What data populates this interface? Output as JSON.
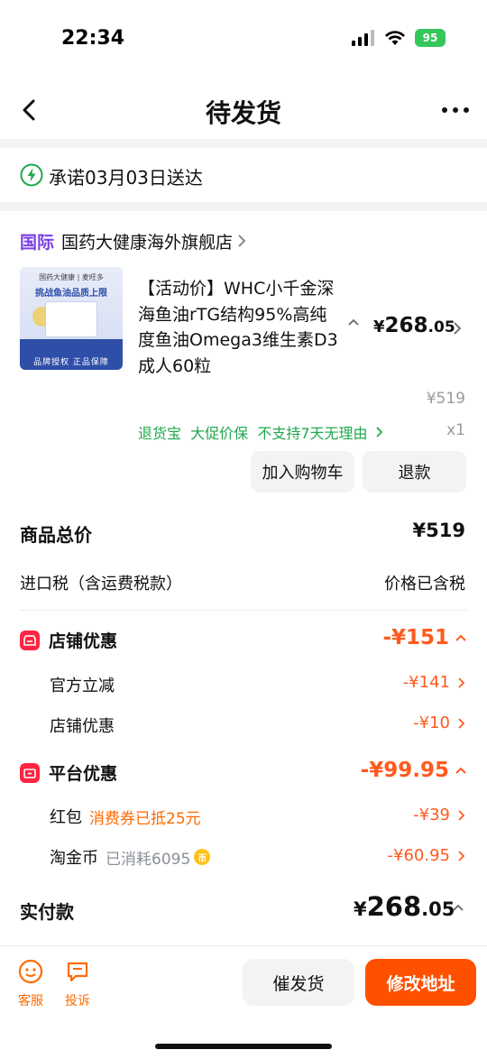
{
  "status_bar": {
    "time": "22:34",
    "battery": "95"
  },
  "nav": {
    "title": "待发货"
  },
  "delivery": {
    "text": "承诺03月03日送达"
  },
  "shop": {
    "tag": "国际",
    "name": "国药大健康海外旗舰店"
  },
  "product": {
    "image_text": {
      "line1": "国药大健康 | 麦旺多",
      "line2": "挑战鱼油品质上限",
      "foot": "品牌授权 正品保障"
    },
    "title": "【活动价】WHC小千金深海鱼油rTG结构95%高纯度鱼油Omega3维生素D3成人60粒",
    "price_symbol": "¥",
    "price_int": "268",
    "price_dec": ".05",
    "original_price": "¥519",
    "tags": "退货宝  大促价保  不支持7天无理由",
    "quantity": "x1",
    "add_cart_label": "加入购物车",
    "refund_label": "退款"
  },
  "summary": {
    "goods_total_label": "商品总价",
    "goods_total_value": "¥519",
    "tax_label": "进口税（含运费税款）",
    "tax_value": "价格已含税"
  },
  "shop_discount": {
    "title": "店铺优惠",
    "total": "-¥151",
    "items": [
      {
        "label": "官方立减",
        "value": "-¥141"
      },
      {
        "label": "店铺优惠",
        "value": "-¥10"
      }
    ]
  },
  "platform_discount": {
    "title": "平台优惠",
    "total": "-¥99.95",
    "items": [
      {
        "label": "红包",
        "note": "消费券已抵25元",
        "value": "-¥39"
      },
      {
        "label": "淘金币",
        "note": "已消耗6095",
        "value": "-¥60.95"
      }
    ]
  },
  "payment": {
    "label": "实付款",
    "symbol": "¥",
    "int": "268",
    "dec": ".05"
  },
  "bottom": {
    "service_label": "客服",
    "complain_label": "投诉",
    "urge_label": "催发货",
    "address_label": "修改地址"
  },
  "colors": {
    "accent": "#ff5000",
    "discount": "#ff5a1f",
    "green": "#21a84e",
    "intl": "#7b3fe4"
  }
}
